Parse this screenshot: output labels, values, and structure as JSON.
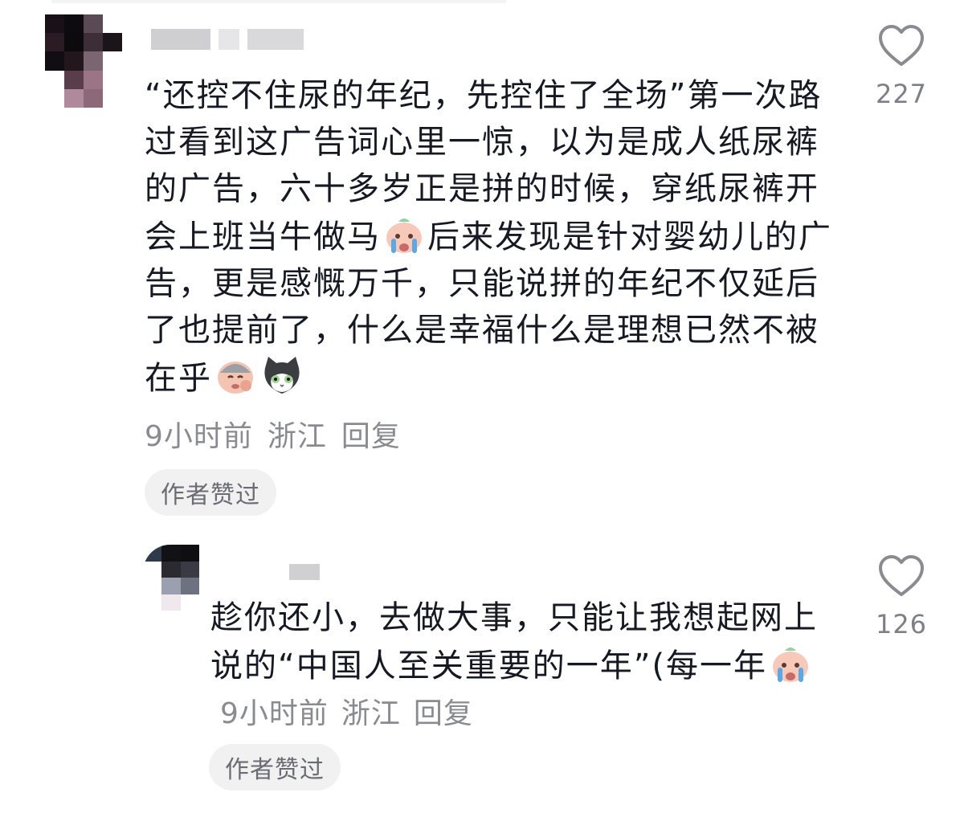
{
  "comments": [
    {
      "text_part1": "“还控不住尿的年纪，先控住了全场”第一次路过看到这广告词心里一惊，以为是成人纸尿裤的广告，六十多岁正是拼的时候，穿纸尿裤开会上班当牛做马",
      "text_part2": "后来发现是针对婴幼儿的广告，更是感慨万千，只能说拼的年纪不仅延后了也提前了，什么是幸福什么是理想已然不被在乎",
      "emojis": [
        "crying-baby-emoji",
        "sad-baby-emoji",
        "cat-emoji"
      ],
      "time": "9小时前",
      "location": "浙江",
      "reply_label": "回复",
      "author_liked_label": "作者赞过",
      "like_count": "227"
    },
    {
      "text": "趁你还小，去做大事，只能让我想起网上说的“中国人至关重要的一年”(每一年",
      "emojis": [
        "crying-baby-emoji"
      ],
      "time": "9小时前",
      "location": "浙江",
      "reply_label": "回复",
      "author_liked_label": "作者赞过",
      "like_count": "126"
    }
  ],
  "icons": {
    "like": "heart-outline-icon"
  },
  "colors": {
    "text": "#161823",
    "meta": "#8a8b91",
    "pill_bg": "#f1f1f2"
  }
}
